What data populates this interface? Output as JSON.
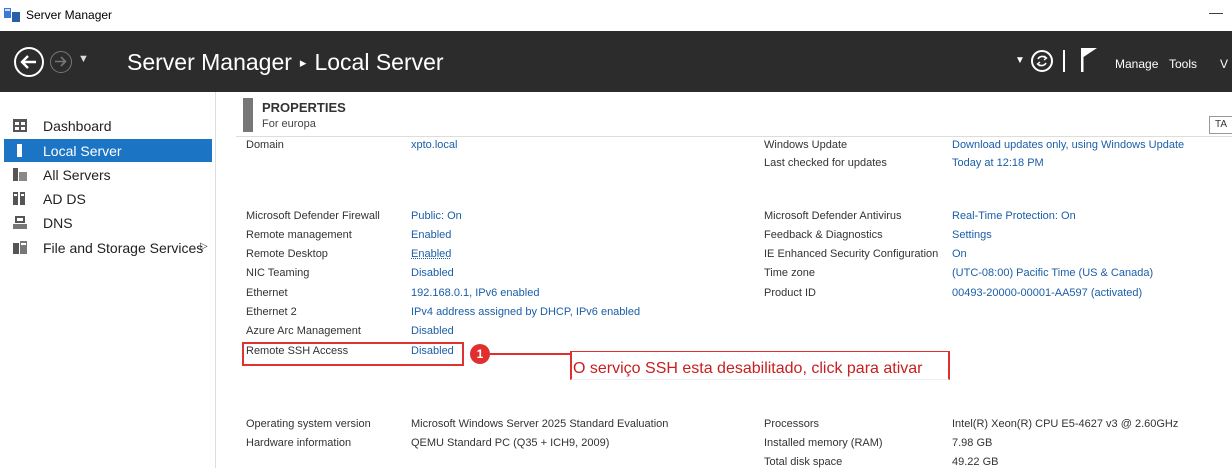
{
  "window": {
    "title": "Server Manager",
    "minimize": "—"
  },
  "header": {
    "app": "Server Manager",
    "separator": "▸",
    "page": "Local Server",
    "menu": [
      "Manage",
      "Tools",
      "V"
    ]
  },
  "sidebar": {
    "items": [
      {
        "label": "Dashboard",
        "icon": "dashboard-icon"
      },
      {
        "label": "Local Server",
        "icon": "local-server-icon",
        "active": true
      },
      {
        "label": "All Servers",
        "icon": "all-servers-icon"
      },
      {
        "label": "AD DS",
        "icon": "ad-ds-icon"
      },
      {
        "label": "DNS",
        "icon": "dns-icon"
      },
      {
        "label": "File and Storage Services",
        "icon": "storage-icon",
        "arrow": "▷"
      }
    ]
  },
  "properties": {
    "title": "PROPERTIES",
    "subtitle": "For europa",
    "tasks": "TA",
    "left": [
      {
        "label": "Domain",
        "value": "xpto.local"
      },
      {
        "label": "Microsoft Defender Firewall",
        "value": "Public: On"
      },
      {
        "label": "Remote management",
        "value": "Enabled"
      },
      {
        "label": "Remote Desktop",
        "value": "Enabled"
      },
      {
        "label": "NIC Teaming",
        "value": "Disabled"
      },
      {
        "label": "Ethernet",
        "value": "192.168.0.1, IPv6 enabled"
      },
      {
        "label": "Ethernet 2",
        "value": "IPv4 address assigned by DHCP, IPv6 enabled"
      },
      {
        "label": "Azure Arc Management",
        "value": "Disabled"
      },
      {
        "label": "Remote SSH Access",
        "value": "Disabled"
      },
      {
        "label": "Operating system version",
        "value": "Microsoft Windows Server 2025 Standard Evaluation"
      },
      {
        "label": "Hardware information",
        "value": "QEMU Standard PC (Q35 + ICH9, 2009)"
      }
    ],
    "right": [
      {
        "label": "Windows Update",
        "value": "Download updates only, using Windows Update"
      },
      {
        "label": "Last checked for updates",
        "value": "Today at 12:18 PM"
      },
      {
        "label": "Microsoft Defender Antivirus",
        "value": "Real-Time Protection: On"
      },
      {
        "label": "Feedback & Diagnostics",
        "value": "Settings"
      },
      {
        "label": "IE Enhanced Security Configuration",
        "value": "On"
      },
      {
        "label": "Time zone",
        "value": "(UTC-08:00) Pacific Time (US & Canada)"
      },
      {
        "label": "Product ID",
        "value": "00493-20000-00001-AA597 (activated)"
      },
      {
        "label": "Processors",
        "value": "Intel(R) Xeon(R) CPU E5-4627 v3 @ 2.60GHz"
      },
      {
        "label": "Installed memory (RAM)",
        "value": "7.98 GB"
      },
      {
        "label": "Total disk space",
        "value": "49.22 GB"
      }
    ]
  },
  "annotation": {
    "badge": "1",
    "text": "O serviço SSH esta desabilitado, click para ativar",
    "color": "#e02f2f"
  }
}
